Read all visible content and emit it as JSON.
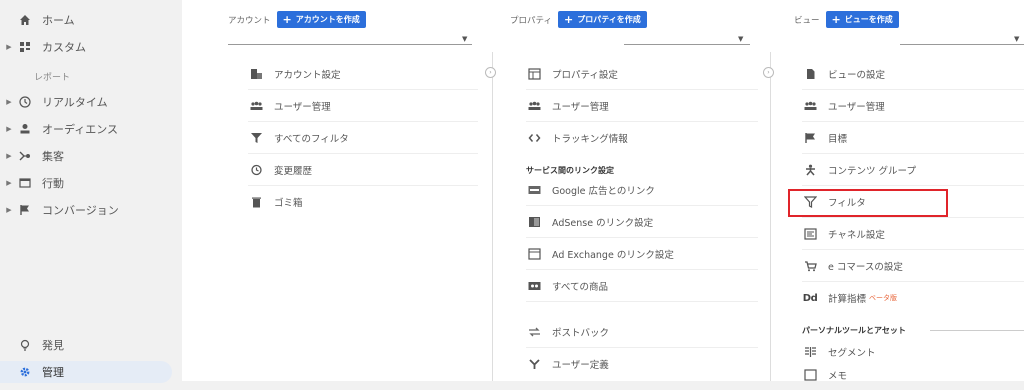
{
  "sidebar": {
    "home": "ホーム",
    "custom": "カスタム",
    "reports_label": "レポート",
    "items": [
      {
        "label": "リアルタイム"
      },
      {
        "label": "オーディエンス"
      },
      {
        "label": "集客"
      },
      {
        "label": "行動"
      },
      {
        "label": "コンバージョン"
      }
    ],
    "discover": "発見",
    "admin": "管理"
  },
  "account": {
    "label": "アカウント",
    "create": "アカウントを作成",
    "items": [
      {
        "label": "アカウント設定",
        "icon": "building-icon"
      },
      {
        "label": "ユーザー管理",
        "icon": "users-icon"
      },
      {
        "label": "すべてのフィルタ",
        "icon": "filter-icon"
      },
      {
        "label": "変更履歴",
        "icon": "history-icon"
      },
      {
        "label": "ゴミ箱",
        "icon": "trash-icon"
      }
    ]
  },
  "property": {
    "label": "プロパティ",
    "create": "プロパティを作成",
    "items": [
      {
        "label": "プロパティ設定"
      },
      {
        "label": "ユーザー管理"
      },
      {
        "label": "トラッキング情報"
      }
    ],
    "links_heading": "サービス間のリンク設定",
    "links": [
      {
        "label": "Google 広告とのリンク"
      },
      {
        "label": "AdSense のリンク設定"
      },
      {
        "label": "Ad Exchange のリンク設定"
      },
      {
        "label": "すべての商品"
      },
      {
        "label": "ポストバック"
      },
      {
        "label": "ユーザー定義"
      }
    ]
  },
  "view": {
    "label": "ビュー",
    "create": "ビューを作成",
    "items": [
      {
        "label": "ビューの設定"
      },
      {
        "label": "ユーザー管理"
      },
      {
        "label": "目標"
      },
      {
        "label": "コンテンツ グループ"
      },
      {
        "label": "フィルタ"
      },
      {
        "label": "チャネル設定"
      },
      {
        "label": "e コマースの設定"
      },
      {
        "label": "計算指標"
      }
    ],
    "calc_prefix": "Dd",
    "beta": "ベータ版",
    "personal_heading": "パーソナルツールとアセット",
    "segment": "セグメント",
    "memo": "メモ"
  },
  "colors": {
    "accent": "#2c6fdb",
    "highlight": "#e0242a"
  }
}
